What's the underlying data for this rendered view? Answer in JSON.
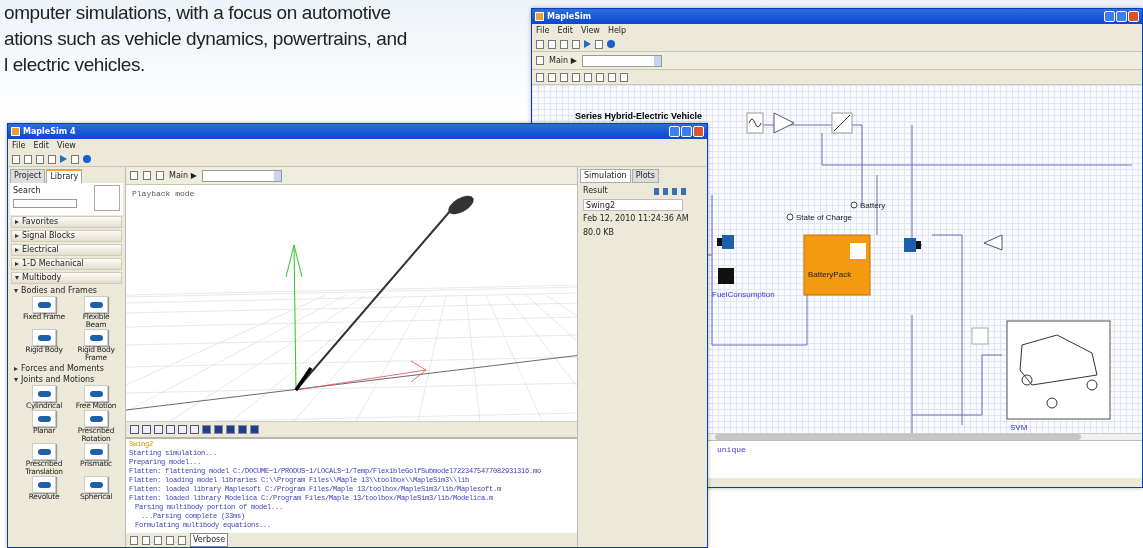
{
  "intro": {
    "lines": [
      "omputer simulations, with a focus on automotive",
      "ations such as vehicle dynamics, powertrains, and",
      "l electric vehicles."
    ]
  },
  "back_window": {
    "title": "MapleSim",
    "menu": [
      "File",
      "Edit",
      "View",
      "Help"
    ],
    "breadcrumb": "Main ▶",
    "diagram_title": "Series Hybrid-Electric Vehicle",
    "soc_label": "State of Charge",
    "battery_label": "Battery",
    "block_label": "BatteryPack",
    "fuel_label": "FuelConsumption",
    "vehicle_label": "SVM",
    "console_text": "unique"
  },
  "front_window": {
    "title": "MapleSim 4",
    "menu": [
      "File",
      "Edit",
      "View"
    ],
    "side_tabs": [
      {
        "label": "Project",
        "selected": false
      },
      {
        "label": "Library",
        "selected": true
      }
    ],
    "search_label": "Search",
    "palettes": [
      {
        "label": "Favorites",
        "expanded": false
      },
      {
        "label": "Signal Blocks",
        "expanded": false
      },
      {
        "label": "Electrical",
        "expanded": false
      },
      {
        "label": "1-D Mechanical",
        "expanded": false
      },
      {
        "label": "Multibody",
        "expanded": true
      }
    ],
    "groups": [
      {
        "label": "Bodies and Frames",
        "expanded": true,
        "items": [
          "Fixed Frame",
          "Flexible Beam",
          "Rigid Body",
          "Rigid Body Frame"
        ]
      },
      {
        "label": "Forces and Moments",
        "expanded": false
      },
      {
        "label": "Joints and Motions",
        "expanded": true,
        "items": [
          "Cylindrical",
          "Free Motion",
          "Planar",
          "Prescribed Rotation",
          "Prescribed Translation",
          "Prismatic",
          "Revolute",
          "Spherical"
        ]
      }
    ],
    "breadcrumb": "Main ▶",
    "viewer_mode": "Playback mode",
    "console_lines": [
      {
        "kind": "title",
        "text": "Swing2"
      },
      {
        "kind": "log",
        "text": "Starting simulation..."
      },
      {
        "kind": "log",
        "text": "Preparing model..."
      },
      {
        "kind": "log",
        "text": "Flatten: flattening model C:/DOCUME~1/PRODUS~1/LOCALS~1/Temp/FlexibleGolfSubmodel7223475477082931316.mo"
      },
      {
        "kind": "log",
        "text": "Flatten: loading model libraries C:\\\\Program Files\\\\Maple 13\\\\toolbox\\\\MapleSim3\\\\lib"
      },
      {
        "kind": "log",
        "text": "Flatten: loaded library Maplesoft C:/Program Files/Maple 13/toolbox/MapleSim3/lib/Maplesoft.m"
      },
      {
        "kind": "log",
        "text": "Flatten: loaded library Modelica C:/Program Files/Maple 13/toolbox/MapleSim3/lib/Modelica.m"
      },
      {
        "kind": "sub",
        "text": "Parsing multibody portion of model..."
      },
      {
        "kind": "sub2",
        "text": "...Parsing complete (33ms)"
      },
      {
        "kind": "sub",
        "text": "Formulating multibody equations..."
      }
    ],
    "log_level": "Verbose",
    "result_tabs": [
      {
        "label": "Simulation",
        "selected": true
      },
      {
        "label": "Plots",
        "selected": false
      }
    ],
    "result_heading": "Result",
    "result_name": "Swing2",
    "result_date": "Feb 12, 2010 11:24:36 AM",
    "result_size": "80.0 KB"
  }
}
